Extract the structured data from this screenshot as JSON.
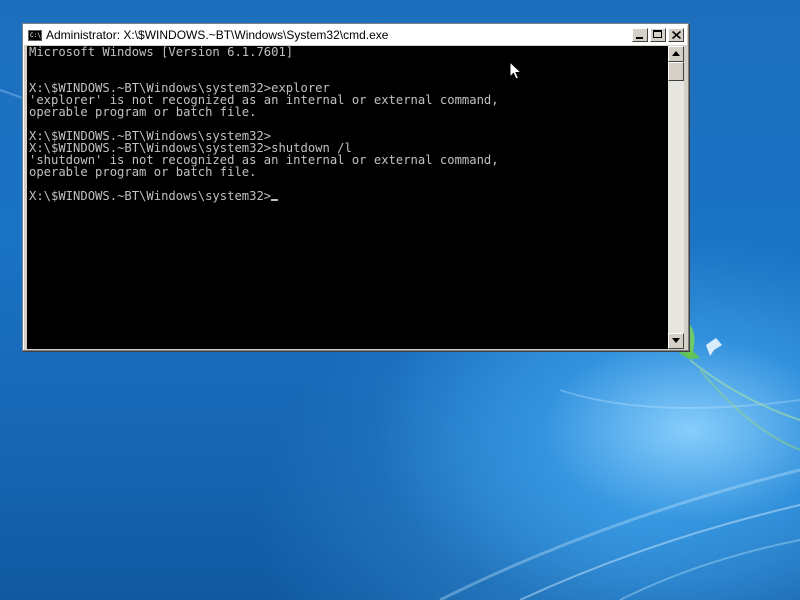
{
  "desktop": {
    "wallpaper_colors": {
      "base": "#1a73c4",
      "glow": "#8cd2ff",
      "accent_leaf": "#7fd34a"
    }
  },
  "window": {
    "title": "Administrator: X:\\$WINDOWS.~BT\\Windows\\System32\\cmd.exe",
    "icon": "console-app-icon",
    "controls": {
      "minimize_icon": "minimize-icon",
      "maximize_icon": "maximize-icon",
      "close_icon": "close-icon"
    }
  },
  "console": {
    "text_color": "#c0c0c0",
    "background": "#000000",
    "lines": [
      "Microsoft Windows [Version 6.1.7601]",
      "",
      "",
      "X:\\$WINDOWS.~BT\\Windows\\system32>explorer",
      "'explorer' is not recognized as an internal or external command,",
      "operable program or batch file.",
      "",
      "X:\\$WINDOWS.~BT\\Windows\\system32>",
      "X:\\$WINDOWS.~BT\\Windows\\system32>shutdown /l",
      "'shutdown' is not recognized as an internal or external command,",
      "operable program or batch file.",
      "",
      "X:\\$WINDOWS.~BT\\Windows\\system32>"
    ]
  },
  "scrollbar": {
    "up_icon": "arrow-up-icon",
    "down_icon": "arrow-down-icon"
  },
  "pointer": {
    "icon": "mouse-pointer-icon"
  }
}
